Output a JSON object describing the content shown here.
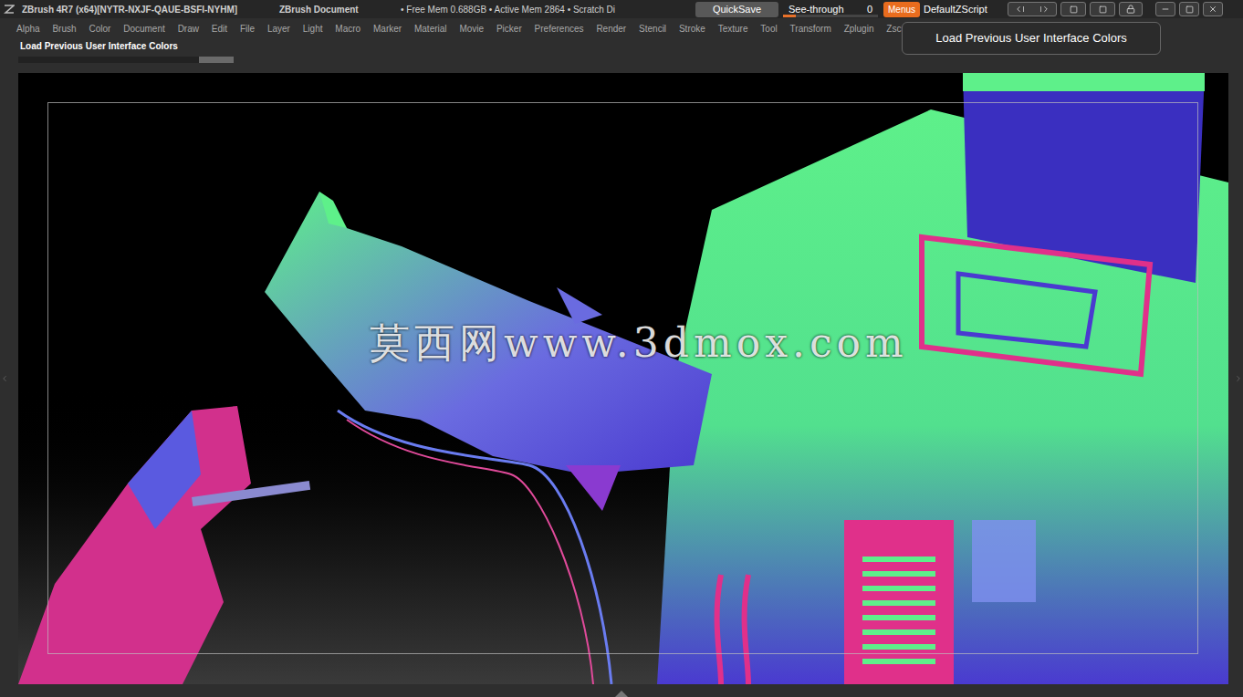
{
  "window": {
    "title": "ZBrush 4R7 (x64)[NYTR-NXJF-QAUE-BSFI-NYHM]",
    "document": "ZBrush Document",
    "memory": "• Free Mem 0.688GB • Active Mem 2864 • Scratch Di"
  },
  "toolbar": {
    "quicksave": "QuickSave",
    "see_through": {
      "label": "See-through",
      "reading": "0",
      "level": 0
    },
    "menus_toggle": {
      "label": "Menus",
      "on": true
    },
    "script": "DefaultZScript"
  },
  "menu_bar": [
    "Alpha",
    "Brush",
    "Color",
    "Document",
    "Draw",
    "Edit",
    "File",
    "Layer",
    "Light",
    "Macro",
    "Marker",
    "Material",
    "Movie",
    "Picker",
    "Preferences",
    "Render",
    "Stencil",
    "Stroke",
    "Texture",
    "Tool",
    "Transform",
    "Zplugin",
    "Zscri"
  ],
  "status_text": "Load Previous User Interface Colors",
  "tooltip": "Load Previous User Interface Colors",
  "watermark": "莫西网www.3dmox.com"
}
